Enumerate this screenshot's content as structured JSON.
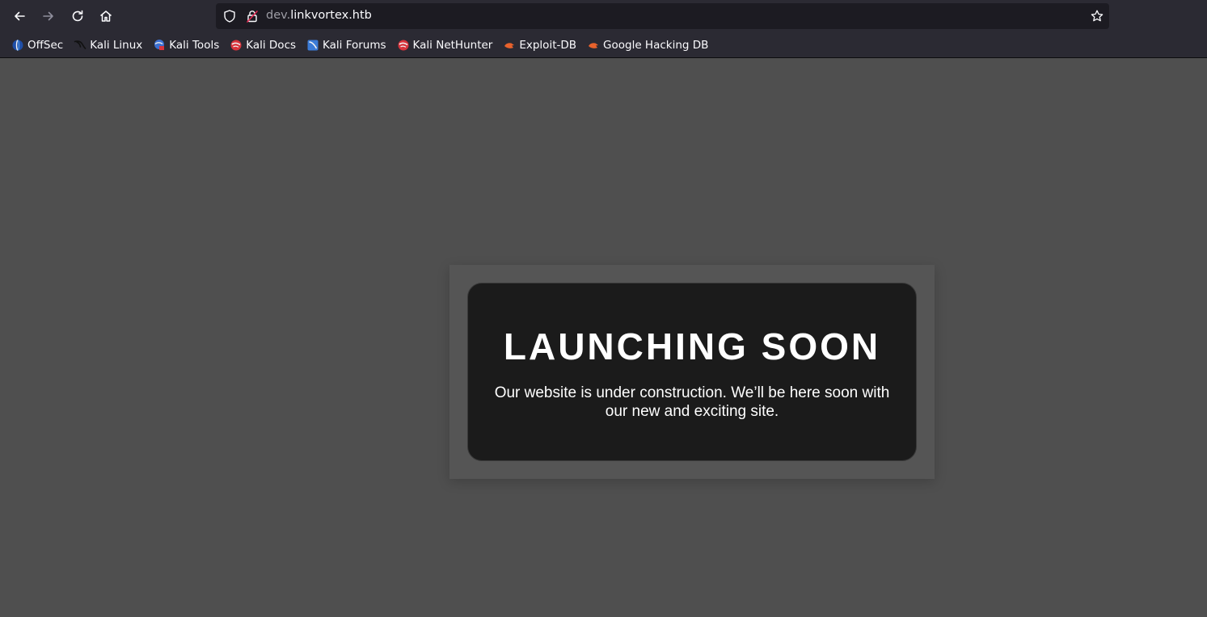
{
  "browser": {
    "url_prefix": "dev.",
    "url_domain": "linkvortex.htb",
    "icons": {
      "back": "back-arrow-icon",
      "forward": "forward-arrow-icon",
      "reload": "reload-icon",
      "home": "home-icon",
      "tracking": "tracking-protection-shield-icon",
      "security": "insecure-lock-icon",
      "bookmark": "bookmark-star-icon"
    }
  },
  "bookmarks": [
    {
      "label": "OffSec",
      "icon": "offsec-icon"
    },
    {
      "label": "Kali Linux",
      "icon": "kali-dragon-icon"
    },
    {
      "label": "Kali Tools",
      "icon": "kali-tools-icon"
    },
    {
      "label": "Kali Docs",
      "icon": "kali-docs-icon"
    },
    {
      "label": "Kali Forums",
      "icon": "kali-forums-icon"
    },
    {
      "label": "Kali NetHunter",
      "icon": "kali-nethunter-icon"
    },
    {
      "label": "Exploit-DB",
      "icon": "exploit-db-icon"
    },
    {
      "label": "Google Hacking DB",
      "icon": "ghdb-icon"
    }
  ],
  "page": {
    "headline": "LAUNCHING SOON",
    "message": "Our website is under construction. We’ll be here soon with our new and exciting site."
  },
  "colors": {
    "page_background": "#4f4f4f",
    "card_background": "#1b1b1b",
    "chrome_background": "#2b2a33",
    "text": "#ffffff"
  }
}
